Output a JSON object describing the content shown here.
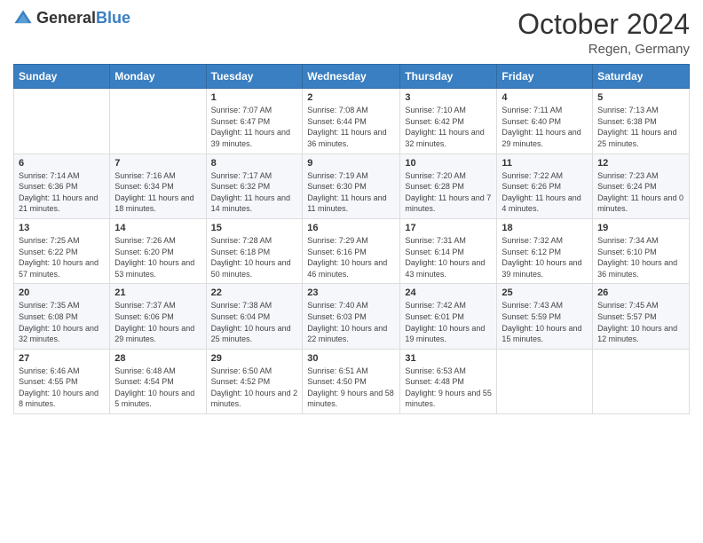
{
  "logo": {
    "general": "General",
    "blue": "Blue"
  },
  "title": "October 2024",
  "location": "Regen, Germany",
  "days_of_week": [
    "Sunday",
    "Monday",
    "Tuesday",
    "Wednesday",
    "Thursday",
    "Friday",
    "Saturday"
  ],
  "weeks": [
    [
      {
        "day": "",
        "content": ""
      },
      {
        "day": "",
        "content": ""
      },
      {
        "day": "1",
        "content": "Sunrise: 7:07 AM\nSunset: 6:47 PM\nDaylight: 11 hours and 39 minutes."
      },
      {
        "day": "2",
        "content": "Sunrise: 7:08 AM\nSunset: 6:44 PM\nDaylight: 11 hours and 36 minutes."
      },
      {
        "day": "3",
        "content": "Sunrise: 7:10 AM\nSunset: 6:42 PM\nDaylight: 11 hours and 32 minutes."
      },
      {
        "day": "4",
        "content": "Sunrise: 7:11 AM\nSunset: 6:40 PM\nDaylight: 11 hours and 29 minutes."
      },
      {
        "day": "5",
        "content": "Sunrise: 7:13 AM\nSunset: 6:38 PM\nDaylight: 11 hours and 25 minutes."
      }
    ],
    [
      {
        "day": "6",
        "content": "Sunrise: 7:14 AM\nSunset: 6:36 PM\nDaylight: 11 hours and 21 minutes."
      },
      {
        "day": "7",
        "content": "Sunrise: 7:16 AM\nSunset: 6:34 PM\nDaylight: 11 hours and 18 minutes."
      },
      {
        "day": "8",
        "content": "Sunrise: 7:17 AM\nSunset: 6:32 PM\nDaylight: 11 hours and 14 minutes."
      },
      {
        "day": "9",
        "content": "Sunrise: 7:19 AM\nSunset: 6:30 PM\nDaylight: 11 hours and 11 minutes."
      },
      {
        "day": "10",
        "content": "Sunrise: 7:20 AM\nSunset: 6:28 PM\nDaylight: 11 hours and 7 minutes."
      },
      {
        "day": "11",
        "content": "Sunrise: 7:22 AM\nSunset: 6:26 PM\nDaylight: 11 hours and 4 minutes."
      },
      {
        "day": "12",
        "content": "Sunrise: 7:23 AM\nSunset: 6:24 PM\nDaylight: 11 hours and 0 minutes."
      }
    ],
    [
      {
        "day": "13",
        "content": "Sunrise: 7:25 AM\nSunset: 6:22 PM\nDaylight: 10 hours and 57 minutes."
      },
      {
        "day": "14",
        "content": "Sunrise: 7:26 AM\nSunset: 6:20 PM\nDaylight: 10 hours and 53 minutes."
      },
      {
        "day": "15",
        "content": "Sunrise: 7:28 AM\nSunset: 6:18 PM\nDaylight: 10 hours and 50 minutes."
      },
      {
        "day": "16",
        "content": "Sunrise: 7:29 AM\nSunset: 6:16 PM\nDaylight: 10 hours and 46 minutes."
      },
      {
        "day": "17",
        "content": "Sunrise: 7:31 AM\nSunset: 6:14 PM\nDaylight: 10 hours and 43 minutes."
      },
      {
        "day": "18",
        "content": "Sunrise: 7:32 AM\nSunset: 6:12 PM\nDaylight: 10 hours and 39 minutes."
      },
      {
        "day": "19",
        "content": "Sunrise: 7:34 AM\nSunset: 6:10 PM\nDaylight: 10 hours and 36 minutes."
      }
    ],
    [
      {
        "day": "20",
        "content": "Sunrise: 7:35 AM\nSunset: 6:08 PM\nDaylight: 10 hours and 32 minutes."
      },
      {
        "day": "21",
        "content": "Sunrise: 7:37 AM\nSunset: 6:06 PM\nDaylight: 10 hours and 29 minutes."
      },
      {
        "day": "22",
        "content": "Sunrise: 7:38 AM\nSunset: 6:04 PM\nDaylight: 10 hours and 25 minutes."
      },
      {
        "day": "23",
        "content": "Sunrise: 7:40 AM\nSunset: 6:03 PM\nDaylight: 10 hours and 22 minutes."
      },
      {
        "day": "24",
        "content": "Sunrise: 7:42 AM\nSunset: 6:01 PM\nDaylight: 10 hours and 19 minutes."
      },
      {
        "day": "25",
        "content": "Sunrise: 7:43 AM\nSunset: 5:59 PM\nDaylight: 10 hours and 15 minutes."
      },
      {
        "day": "26",
        "content": "Sunrise: 7:45 AM\nSunset: 5:57 PM\nDaylight: 10 hours and 12 minutes."
      }
    ],
    [
      {
        "day": "27",
        "content": "Sunrise: 6:46 AM\nSunset: 4:55 PM\nDaylight: 10 hours and 8 minutes."
      },
      {
        "day": "28",
        "content": "Sunrise: 6:48 AM\nSunset: 4:54 PM\nDaylight: 10 hours and 5 minutes."
      },
      {
        "day": "29",
        "content": "Sunrise: 6:50 AM\nSunset: 4:52 PM\nDaylight: 10 hours and 2 minutes."
      },
      {
        "day": "30",
        "content": "Sunrise: 6:51 AM\nSunset: 4:50 PM\nDaylight: 9 hours and 58 minutes."
      },
      {
        "day": "31",
        "content": "Sunrise: 6:53 AM\nSunset: 4:48 PM\nDaylight: 9 hours and 55 minutes."
      },
      {
        "day": "",
        "content": ""
      },
      {
        "day": "",
        "content": ""
      }
    ]
  ]
}
